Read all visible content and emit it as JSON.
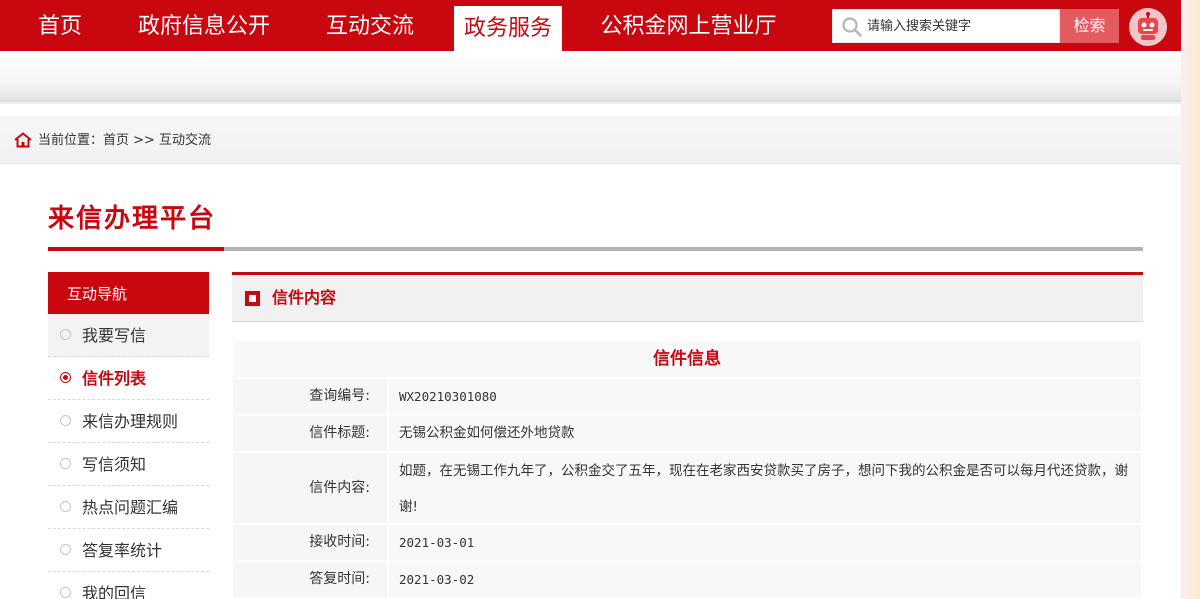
{
  "nav": {
    "items": [
      {
        "label": "首页",
        "active": false
      },
      {
        "label": "政府信息公开",
        "active": false
      },
      {
        "label": "互动交流",
        "active": false
      },
      {
        "label": "政务服务",
        "active": true
      },
      {
        "label": "公积金网上营业厅",
        "active": false
      }
    ]
  },
  "search": {
    "placeholder": "请输入搜索关键字",
    "button_label": "检索"
  },
  "breadcrumb": {
    "text": "当前位置：首页 >> 互动交流"
  },
  "platform_title": "来信办理平台",
  "sidebar": {
    "heading": "互动导航",
    "items": [
      {
        "label": "我要写信",
        "active": false
      },
      {
        "label": "信件列表",
        "active": true
      },
      {
        "label": "来信办理规则",
        "active": false
      },
      {
        "label": "写信须知",
        "active": false
      },
      {
        "label": "热点问题汇编",
        "active": false
      },
      {
        "label": "答复率统计",
        "active": false
      },
      {
        "label": "我的回信",
        "active": false
      }
    ]
  },
  "content": {
    "header_title": "信件内容",
    "caption": "信件信息",
    "rows": [
      {
        "label": "查询编号:",
        "value": "WX20210301080"
      },
      {
        "label": "信件标题:",
        "value": "无锡公积金如何偿还外地贷款"
      },
      {
        "label": "信件内容:",
        "value": "如题，在无锡工作九年了，公积金交了五年，现在在老家西安贷款买了房子，想问下我的公积金是否可以每月代还贷款，谢谢!"
      },
      {
        "label": "接收时间:",
        "value": "2021-03-01"
      },
      {
        "label": "答复时间:",
        "value": "2021-03-02"
      }
    ]
  },
  "colors": {
    "brand_red": "#c8070f",
    "search_button": "#e35a5f"
  },
  "icons": [
    "search-icon",
    "robot-icon",
    "home-icon",
    "square-bullet-icon",
    "radio-bullet-icon"
  ]
}
